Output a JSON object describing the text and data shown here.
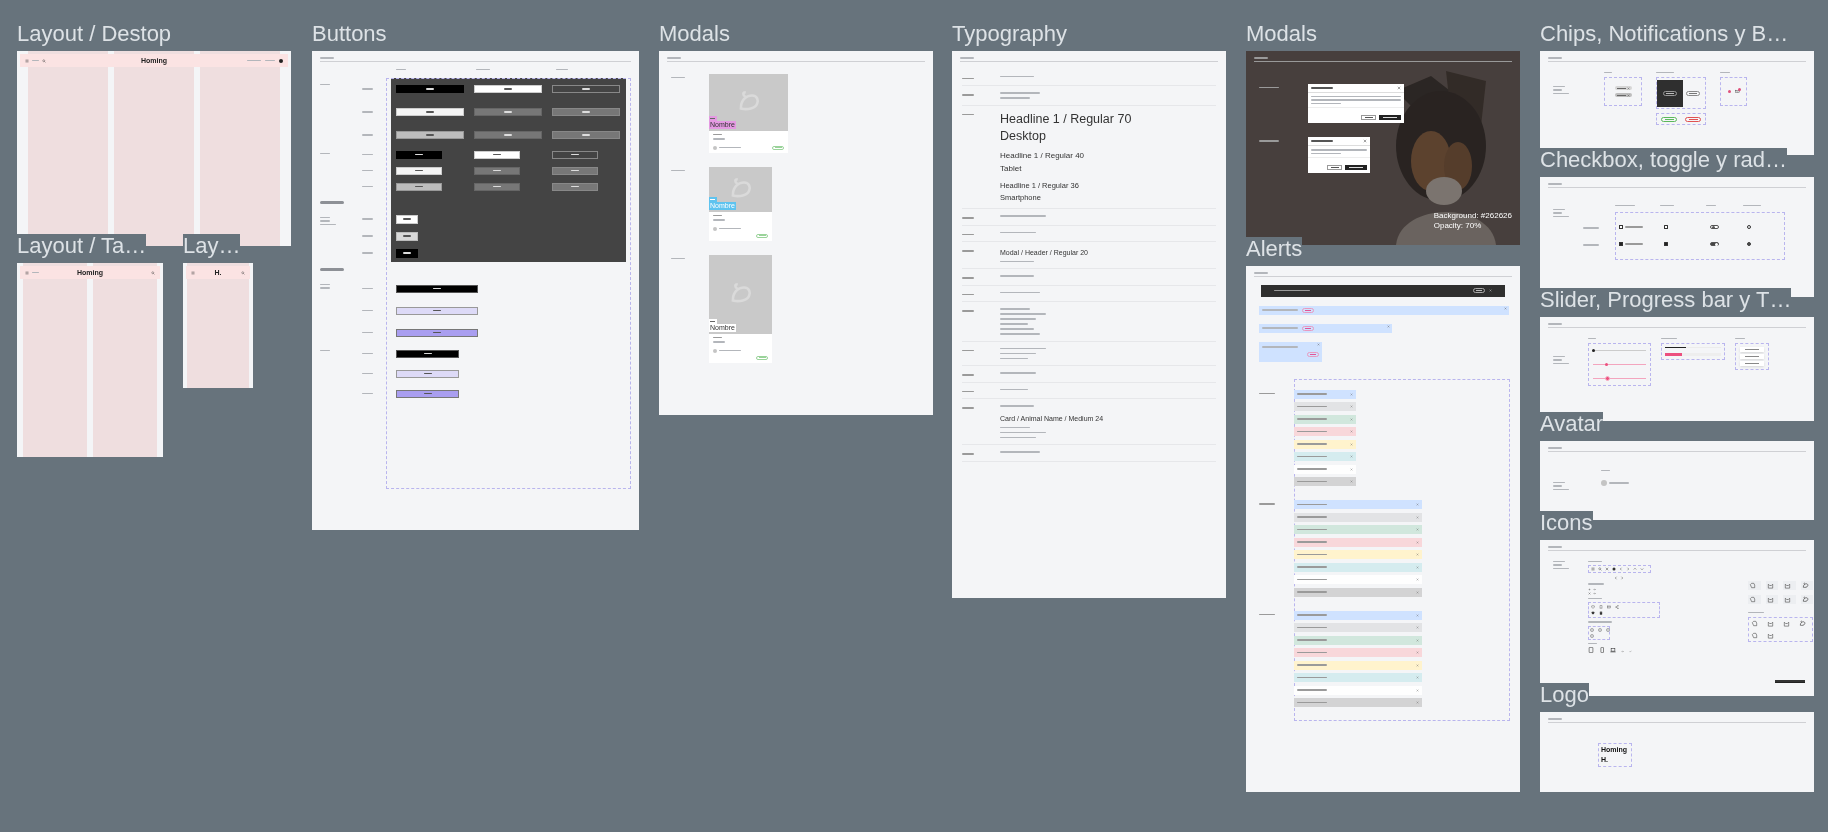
{
  "canvas": {
    "frames": [
      {
        "kind": "layout-desktop",
        "title": "Layout / Destop",
        "nav": {
          "logo": "Homing"
        }
      },
      {
        "kind": "layout-tablet",
        "title": "Layout / Ta…",
        "nav": {
          "logo": "Homing"
        }
      },
      {
        "kind": "layout-smartphone",
        "title": "Lay…",
        "nav": {
          "logo": "H."
        }
      },
      {
        "kind": "buttons",
        "title": "Buttons",
        "sections": [
          {
            "kind": "large",
            "panel": true,
            "rows": [
              {
                "buttons": [
                  {
                    "kind": "primary-standard"
                  },
                  {
                    "kind": "secondary-standard"
                  },
                  {
                    "kind": "outlined-standard"
                  }
                ]
              },
              {
                "buttons": [
                  {
                    "kind": "primary-hover"
                  },
                  {
                    "kind": "secondary-hover"
                  },
                  {
                    "kind": "outlined-hover"
                  }
                ]
              },
              {
                "buttons": [
                  {
                    "kind": "primary-pressed"
                  },
                  {
                    "kind": "secondary-pressed"
                  },
                  {
                    "kind": "outlined-pressed"
                  }
                ]
              }
            ]
          },
          {
            "kind": "small",
            "panel": true,
            "rows": [
              {
                "buttons": [
                  {
                    "kind": "primary-standard"
                  },
                  {
                    "kind": "secondary-standard"
                  },
                  {
                    "kind": "outlined-standard"
                  }
                ]
              },
              {
                "buttons": [
                  {
                    "kind": "primary-hover"
                  },
                  {
                    "kind": "secondary-hover"
                  },
                  {
                    "kind": "outlined-hover"
                  }
                ]
              },
              {
                "buttons": [
                  {
                    "kind": "primary-pressed"
                  },
                  {
                    "kind": "secondary-pressed"
                  },
                  {
                    "kind": "outlined-pressed"
                  }
                ]
              }
            ]
          },
          {
            "kind": "heading",
            "panel": true
          },
          {
            "kind": "cta",
            "panel": true,
            "rows": [
              {
                "buttons": [
                  {
                    "kind": "cta-standard"
                  }
                ]
              },
              {
                "buttons": [
                  {
                    "kind": "cta-hover"
                  }
                ]
              },
              {
                "buttons": [
                  {
                    "kind": "cta-pressed"
                  }
                ]
              }
            ]
          },
          {
            "kind": "heading",
            "panel": false
          },
          {
            "kind": "form",
            "panel": false,
            "rows": [
              {
                "buttons": [
                  {
                    "kind": "form-standard"
                  }
                ]
              },
              {
                "buttons": [
                  {
                    "kind": "form-hover"
                  }
                ]
              },
              {
                "buttons": [
                  {
                    "kind": "form-pressed"
                  }
                ]
              }
            ]
          },
          {
            "kind": "formsm",
            "panel": false,
            "rows": [
              {
                "buttons": [
                  {
                    "kind": "form-standard"
                  }
                ]
              },
              {
                "buttons": [
                  {
                    "kind": "form-hover"
                  }
                ]
              },
              {
                "buttons": [
                  {
                    "kind": "form-pressed"
                  }
                ]
              }
            ]
          }
        ]
      },
      {
        "kind": "cards",
        "title": "Modals",
        "groups": [
          {
            "kind": "desktop",
            "card": {
              "name": "Nombre",
              "color": "#e49ae2"
            }
          },
          {
            "kind": "tablet",
            "card": {
              "name": "Nombre",
              "color": "#5ec3ef"
            }
          },
          {
            "kind": "smartphone",
            "card": {
              "name": "Nombre",
              "color": "#ffffff"
            }
          }
        ]
      },
      {
        "kind": "typography",
        "title": "Typography",
        "rows": [
          {
            "lines": [
              {
                "kind": "tiny"
              }
            ]
          },
          {
            "lines": [
              {
                "kind": "tiny"
              },
              {
                "kind": "tiny"
              }
            ]
          },
          {
            "lines": [
              {
                "kind": "h70",
                "text": "Headline 1 / Regular 70"
              },
              {
                "kind": "h70",
                "text": "Desktop"
              },
              {
                "kind": "h40",
                "text": "Headline 1 / Regular 40"
              },
              {
                "kind": "h40",
                "text": "Tablet"
              },
              {
                "kind": "h36",
                "text": "Headline 1 / Regular 36"
              },
              {
                "kind": "h36",
                "text": "Smartphone"
              }
            ]
          },
          {
            "lines": [
              {
                "kind": "tiny"
              }
            ]
          },
          {
            "lines": [
              {
                "kind": "tiny"
              }
            ]
          },
          {
            "lines": [
              {
                "kind": "medium",
                "text": "Modal / Header / Regular 20"
              },
              {
                "kind": "tiny"
              }
            ]
          },
          {
            "lines": [
              {
                "kind": "tiny"
              }
            ]
          },
          {
            "lines": [
              {
                "kind": "tiny"
              }
            ]
          },
          {
            "lines": [
              {
                "kind": "tiny"
              },
              {
                "kind": "tiny"
              },
              {
                "kind": "tiny"
              },
              {
                "kind": "tiny"
              },
              {
                "kind": "tiny"
              },
              {
                "kind": "tiny"
              }
            ]
          },
          {
            "lines": [
              {
                "kind": "tiny"
              },
              {
                "kind": "tiny"
              },
              {
                "kind": "tiny"
              }
            ]
          },
          {
            "lines": [
              {
                "kind": "tiny"
              }
            ]
          },
          {
            "lines": [
              {
                "kind": "tiny"
              }
            ]
          },
          {
            "lines": [
              {
                "kind": "tiny"
              },
              {
                "kind": "medium",
                "text": "Card / Animal Name / Medium 24"
              },
              {
                "kind": "tiny"
              },
              {
                "kind": "tiny"
              },
              {
                "kind": "tiny"
              }
            ]
          },
          {
            "lines": [
              {
                "kind": "tiny"
              }
            ]
          }
        ]
      },
      {
        "kind": "modals",
        "title": "Modals",
        "note": [
          "Background: #262626",
          "Opacity: 70%"
        ],
        "dialogs": [
          {
            "kind": "wide"
          },
          {
            "kind": "narrow"
          }
        ]
      },
      {
        "kind": "alerts",
        "title": "Alerts",
        "inline": [
          {
            "kind": "wide"
          },
          {
            "kind": "medium"
          },
          {
            "kind": "stacked"
          }
        ],
        "groups": [
          {
            "kind": "smartphone",
            "alerts": [
              {
                "color": "#cfe2ff"
              },
              {
                "color": "#e2e3e5"
              },
              {
                "color": "#d1e7dd"
              },
              {
                "color": "#f8d7da"
              },
              {
                "color": "#fff3cd"
              },
              {
                "color": "#d5ecef"
              },
              {
                "color": "#fefefe"
              },
              {
                "color": "#d3d3d4"
              }
            ]
          },
          {
            "kind": "tablet",
            "alerts": [
              {
                "color": "#cfe2ff"
              },
              {
                "color": "#e2e3e5"
              },
              {
                "color": "#d1e7dd"
              },
              {
                "color": "#f8d7da"
              },
              {
                "color": "#fff3cd"
              },
              {
                "color": "#d5ecef"
              },
              {
                "color": "#fefefe"
              },
              {
                "color": "#d3d3d4"
              }
            ]
          },
          {
            "kind": "desktop",
            "alerts": [
              {
                "color": "#cfe2ff"
              },
              {
                "color": "#e2e3e5"
              },
              {
                "color": "#d1e7dd"
              },
              {
                "color": "#f8d7da"
              },
              {
                "color": "#fff3cd"
              },
              {
                "color": "#d5ecef"
              },
              {
                "color": "#fefefe"
              },
              {
                "color": "#d3d3d4"
              }
            ]
          }
        ]
      },
      {
        "kind": "chips",
        "title": "Chips, Notifications y B…",
        "statuses": [
          {
            "color": "#5cb85c"
          },
          {
            "color": "#e05252"
          }
        ]
      },
      {
        "kind": "checkbox",
        "title": "Checkbox, toggle y rad…",
        "rows": [
          {
            "checked": false,
            "on": false,
            "selected": false
          },
          {
            "checked": true,
            "on": true,
            "selected": true
          }
        ]
      },
      {
        "kind": "slider",
        "title": "Slider, Progress bar y T…",
        "sliders": [
          {
            "kind": "default",
            "level": 0
          },
          {
            "kind": "active",
            "level": 0.25
          },
          {
            "kind": "pressed",
            "level": 0.25
          }
        ],
        "progress": [
          {
            "kind": "dark",
            "level": 0.37
          },
          {
            "kind": "accent",
            "level": 0.3
          }
        ]
      },
      {
        "kind": "avatar",
        "title": "Avatar"
      },
      {
        "kind": "icons",
        "title": "Icons"
      },
      {
        "kind": "logo",
        "title": "Logo",
        "logo": "Homing",
        "mark": "H."
      }
    ]
  }
}
